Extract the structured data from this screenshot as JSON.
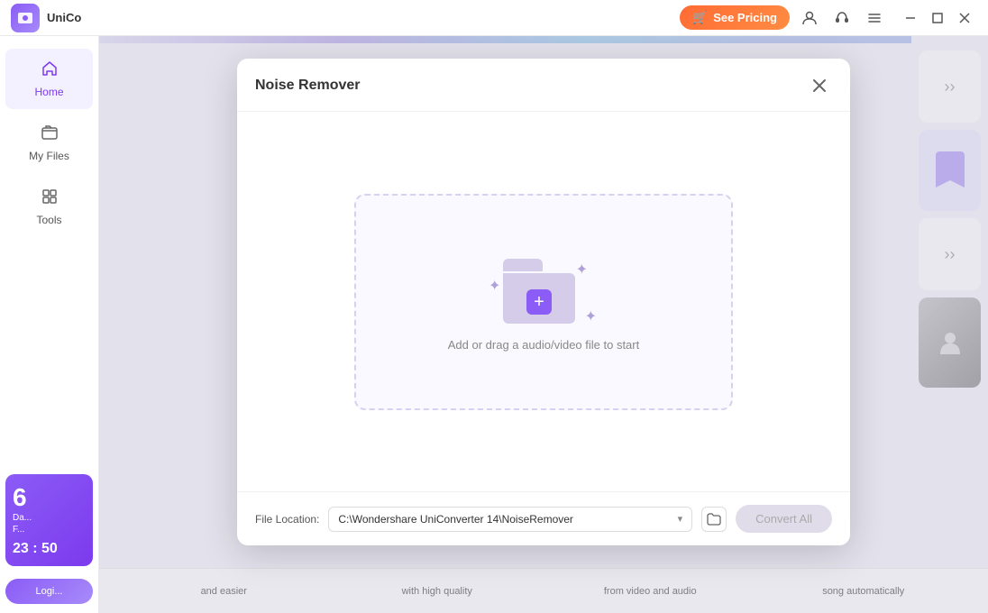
{
  "titlebar": {
    "app_name": "UniCo",
    "see_pricing_label": "See Pricing",
    "cart_icon": "🛒",
    "user_icon": "👤",
    "headset_icon": "🎧",
    "menu_icon": "☰",
    "minimize_icon": "—",
    "maximize_icon": "☐",
    "close_icon": "✕"
  },
  "sidebar": {
    "items": [
      {
        "id": "home",
        "label": "Home",
        "icon": "⌂",
        "active": true
      },
      {
        "id": "my-files",
        "label": "My Files",
        "icon": "📁",
        "active": false
      },
      {
        "id": "tools",
        "label": "Tools",
        "icon": "🔧",
        "active": false
      }
    ],
    "promo": {
      "day": "6",
      "title_line1": "Da...",
      "title_line2": "F...",
      "timer": "23 : 50"
    },
    "login_label": "Logi..."
  },
  "modal": {
    "title": "Noise Remover",
    "close_icon": "✕",
    "dropzone_text": "Add or drag a audio/video file to start",
    "add_icon": "+",
    "file_location_label": "File Location:",
    "file_location_value": "C:\\Wondershare UniConverter 14\\NoiseRemover",
    "convert_all_label": "Convert All"
  },
  "bottom_bar": {
    "features": [
      "and easier",
      "with high quality",
      "from video and audio",
      "song automatically"
    ]
  }
}
